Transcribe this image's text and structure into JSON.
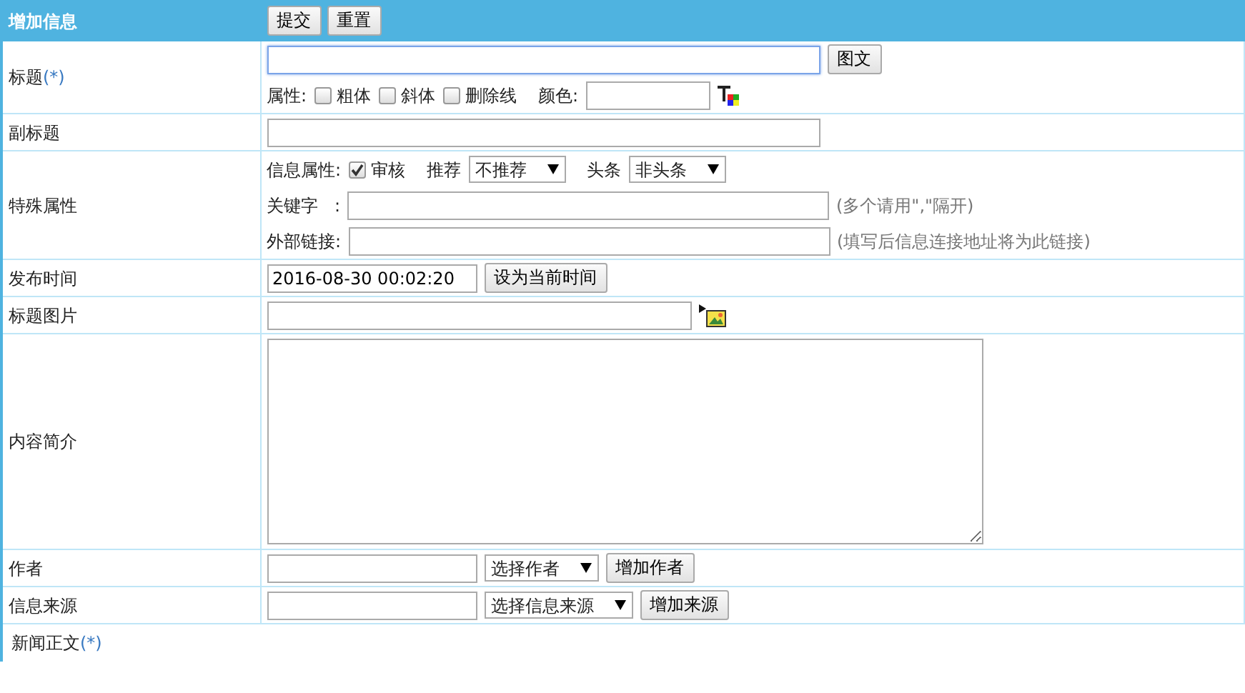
{
  "header": {
    "title": "增加信息",
    "buttons": [
      "提交",
      "重置"
    ]
  },
  "rows": [
    {
      "label": "标题",
      "mark": "(*)",
      "lines": [
        [
          {
            "kind": "titlefield",
            "focused": true
          },
          {
            "kind": "button",
            "label": "图文"
          }
        ],
        [
          {
            "kind": "text",
            "text": "属性:"
          },
          {
            "kind": "checkbox",
            "label": "粗体",
            "checked": false
          },
          {
            "kind": "checkbox",
            "label": "斜体",
            "checked": false
          },
          {
            "kind": "checkbox",
            "label": "删除线",
            "checked": false
          },
          {
            "kind": "gaptext",
            "text": "颜色:"
          },
          {
            "kind": "colorfield"
          },
          {
            "kind": "coloricon"
          }
        ]
      ]
    },
    {
      "label": "副标题",
      "lines": [
        [
          {
            "kind": "titlefield",
            "focused": false
          }
        ]
      ]
    },
    {
      "label": "特殊属性",
      "lines": [
        [
          {
            "kind": "text",
            "text": "信息属性:"
          },
          {
            "kind": "checkbox",
            "label": "审核",
            "checked": true
          },
          {
            "kind": "gaptext",
            "text": "推荐"
          },
          {
            "kind": "select",
            "value": "不推荐"
          },
          {
            "kind": "gaptext",
            "text": "头条"
          },
          {
            "kind": "select",
            "value": "非头条"
          }
        ],
        [
          {
            "kind": "text",
            "text": "关键字   :"
          },
          {
            "kind": "keyfield"
          },
          {
            "kind": "hint",
            "text": "(多个请用\",\"隔开)"
          }
        ],
        [
          {
            "kind": "text",
            "text": "外部链接:"
          },
          {
            "kind": "keyfield"
          },
          {
            "kind": "hint",
            "text": "(填写后信息连接地址将为此链接)"
          }
        ]
      ]
    },
    {
      "label": "发布时间",
      "lines": [
        [
          {
            "kind": "datefield",
            "value": "2016-08-30 00:02:20"
          },
          {
            "kind": "button",
            "label": "设为当前时间"
          }
        ]
      ]
    },
    {
      "label": "标题图片",
      "lines": [
        [
          {
            "kind": "pathfield"
          },
          {
            "kind": "imageicon"
          }
        ]
      ]
    },
    {
      "label": "内容简介",
      "lines": [
        [
          {
            "kind": "textarea"
          }
        ]
      ]
    },
    {
      "label": "作者",
      "lines": [
        [
          {
            "kind": "datefield"
          },
          {
            "kind": "select",
            "value": "选择作者"
          },
          {
            "kind": "button",
            "label": "增加作者"
          }
        ]
      ]
    },
    {
      "label": "信息来源",
      "lines": [
        [
          {
            "kind": "datefield"
          },
          {
            "kind": "select",
            "value": "选择信息来源"
          },
          {
            "kind": "button",
            "label": "增加来源"
          }
        ]
      ]
    }
  ],
  "footer": {
    "label": "新闻正文",
    "mark": "(*)"
  }
}
